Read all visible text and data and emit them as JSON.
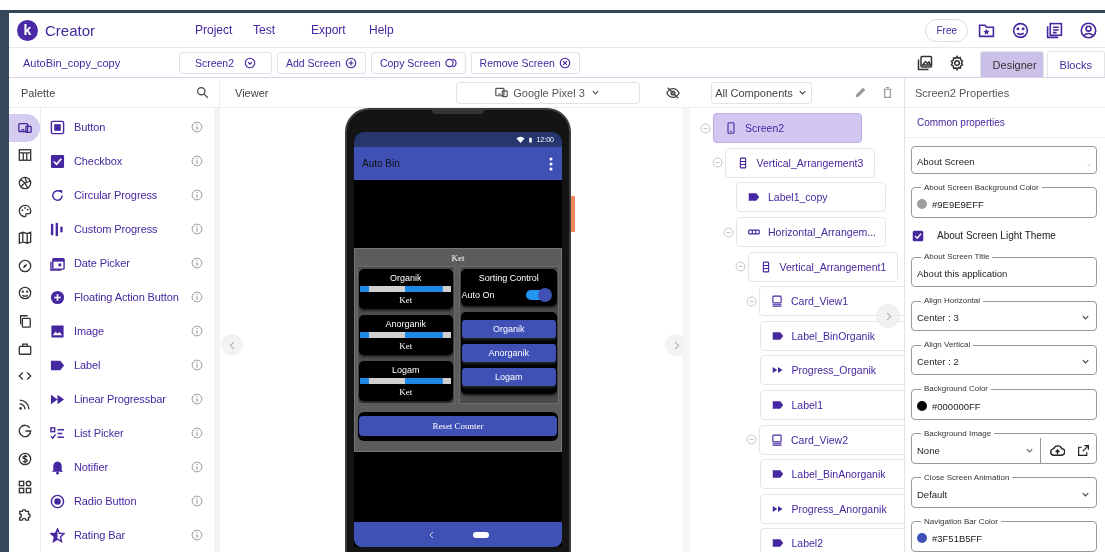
{
  "app": {
    "logo_letter": "k",
    "brand": "Creator",
    "menu": [
      "Project",
      "Test",
      "Export",
      "Help"
    ],
    "plan": "Free"
  },
  "toolbar": {
    "project": "AutoBin_copy_copy",
    "screen": "Screen2",
    "actions": [
      {
        "label": "Add Screen",
        "kind": "add"
      },
      {
        "label": "Copy Screen",
        "kind": "copy"
      },
      {
        "label": "Remove Screen",
        "kind": "remove"
      }
    ],
    "views": [
      {
        "label": "Designer",
        "selected": true
      },
      {
        "label": "Blocks",
        "selected": false
      }
    ]
  },
  "palette": {
    "title": "Palette",
    "categories": [
      {
        "kind": "ui",
        "selected": true
      },
      {
        "kind": "layout",
        "selected": false
      },
      {
        "kind": "media",
        "selected": false
      },
      {
        "kind": "drawing",
        "selected": false
      },
      {
        "kind": "maps",
        "selected": false
      },
      {
        "kind": "sensors",
        "selected": false
      },
      {
        "kind": "social",
        "selected": false
      },
      {
        "kind": "storage",
        "selected": false
      },
      {
        "kind": "briefcase",
        "selected": false
      },
      {
        "kind": "code",
        "selected": false
      },
      {
        "kind": "feed",
        "selected": false
      },
      {
        "kind": "g",
        "selected": false
      },
      {
        "kind": "money",
        "selected": false
      },
      {
        "kind": "widgets",
        "selected": false
      },
      {
        "kind": "puzzle",
        "selected": false
      }
    ],
    "items": [
      {
        "label": "Button",
        "kind": "button"
      },
      {
        "label": "Checkbox",
        "kind": "checkbox"
      },
      {
        "label": "Circular Progress",
        "kind": "circular"
      },
      {
        "label": "Custom Progress",
        "kind": "custom"
      },
      {
        "label": "Date Picker",
        "kind": "date"
      },
      {
        "label": "Floating Action Button",
        "kind": "fab"
      },
      {
        "label": "Image",
        "kind": "image"
      },
      {
        "label": "Label",
        "kind": "label"
      },
      {
        "label": "Linear Progressbar",
        "kind": "linear"
      },
      {
        "label": "List Picker",
        "kind": "list"
      },
      {
        "label": "Notifier",
        "kind": "notifier"
      },
      {
        "label": "Radio Button",
        "kind": "radio"
      },
      {
        "label": "Rating Bar",
        "kind": "rating"
      }
    ]
  },
  "viewer": {
    "title": "Viewer",
    "device": "Google Pixel 3",
    "phone": {
      "time": "12:00",
      "app_title": "Auto Bin",
      "heading": "Ket",
      "bins": [
        {
          "name": "Organik",
          "caption": "Ket",
          "level": 0.91
        },
        {
          "name": "Anorganik",
          "caption": "Ket",
          "level": 0.91
        },
        {
          "name": "Logam",
          "caption": "Ket",
          "level": 0.91
        }
      ],
      "control": {
        "title": "Sorting Control",
        "switch_label": "Auto On",
        "switch_on": true,
        "buttons": [
          "Organik",
          "Anorganik",
          "Logam"
        ]
      },
      "reset_button": "Reset Counter"
    }
  },
  "components": {
    "filter": "All Components",
    "tree": [
      {
        "label": "Screen2",
        "kind": "screen",
        "selected": true,
        "expanded": true,
        "children": [
          {
            "label": "Vertical_Arrangement3",
            "kind": "vertical",
            "selected": false,
            "expanded": true,
            "children": [
              {
                "label": "Label1_copy",
                "kind": "label",
                "selected": false
              },
              {
                "label": "Horizontal_Arrangem...",
                "kind": "horizontal",
                "selected": false,
                "expanded": true,
                "children": [
                  {
                    "label": "Vertical_Arrangement1",
                    "kind": "vertical",
                    "selected": false,
                    "expanded": true,
                    "children": [
                      {
                        "label": "Card_View1",
                        "kind": "card",
                        "selected": false,
                        "expanded": true,
                        "children": [
                          {
                            "label": "Label_BinOrganik",
                            "kind": "label",
                            "selected": false
                          },
                          {
                            "label": "Progress_Organik",
                            "kind": "progress",
                            "selected": false
                          },
                          {
                            "label": "Label1",
                            "kind": "label",
                            "selected": false
                          }
                        ]
                      },
                      {
                        "label": "Card_View2",
                        "kind": "card",
                        "selected": false,
                        "expanded": true,
                        "children": [
                          {
                            "label": "Label_BinAnorganik",
                            "kind": "label",
                            "selected": false
                          },
                          {
                            "label": "Progress_Anorganik",
                            "kind": "progress",
                            "selected": false
                          },
                          {
                            "label": "Label2",
                            "kind": "label",
                            "selected": false
                          }
                        ]
                      }
                    ]
                  }
                ]
              }
            ]
          }
        ]
      }
    ]
  },
  "properties": {
    "title": "Screen2 Properties",
    "section": "Common properties",
    "fields": [
      {
        "kind": "textarea",
        "value": "About Screen"
      },
      {
        "kind": "color",
        "label": "About Screen Background Color",
        "value": "#9E9E9EFF",
        "color": "#9e9e9e"
      },
      {
        "kind": "checkbox",
        "label": "About Screen Light Theme",
        "checked": true
      },
      {
        "kind": "text",
        "label": "About Screen Title",
        "value": "About this application"
      },
      {
        "kind": "select",
        "label": "Align Horizontal",
        "value": "Center : 3"
      },
      {
        "kind": "select",
        "label": "Align Vertical",
        "value": "Center : 2"
      },
      {
        "kind": "color",
        "label": "Background Color",
        "value": "#000000FF",
        "color": "#000000"
      },
      {
        "kind": "asset",
        "label": "Background Image",
        "value": "None"
      },
      {
        "kind": "select",
        "label": "Close Screen Animation",
        "value": "Default"
      },
      {
        "kind": "color",
        "label": "Navigation Bar Color",
        "value": "#3F51B5FF",
        "color": "#3f51b5"
      }
    ]
  }
}
